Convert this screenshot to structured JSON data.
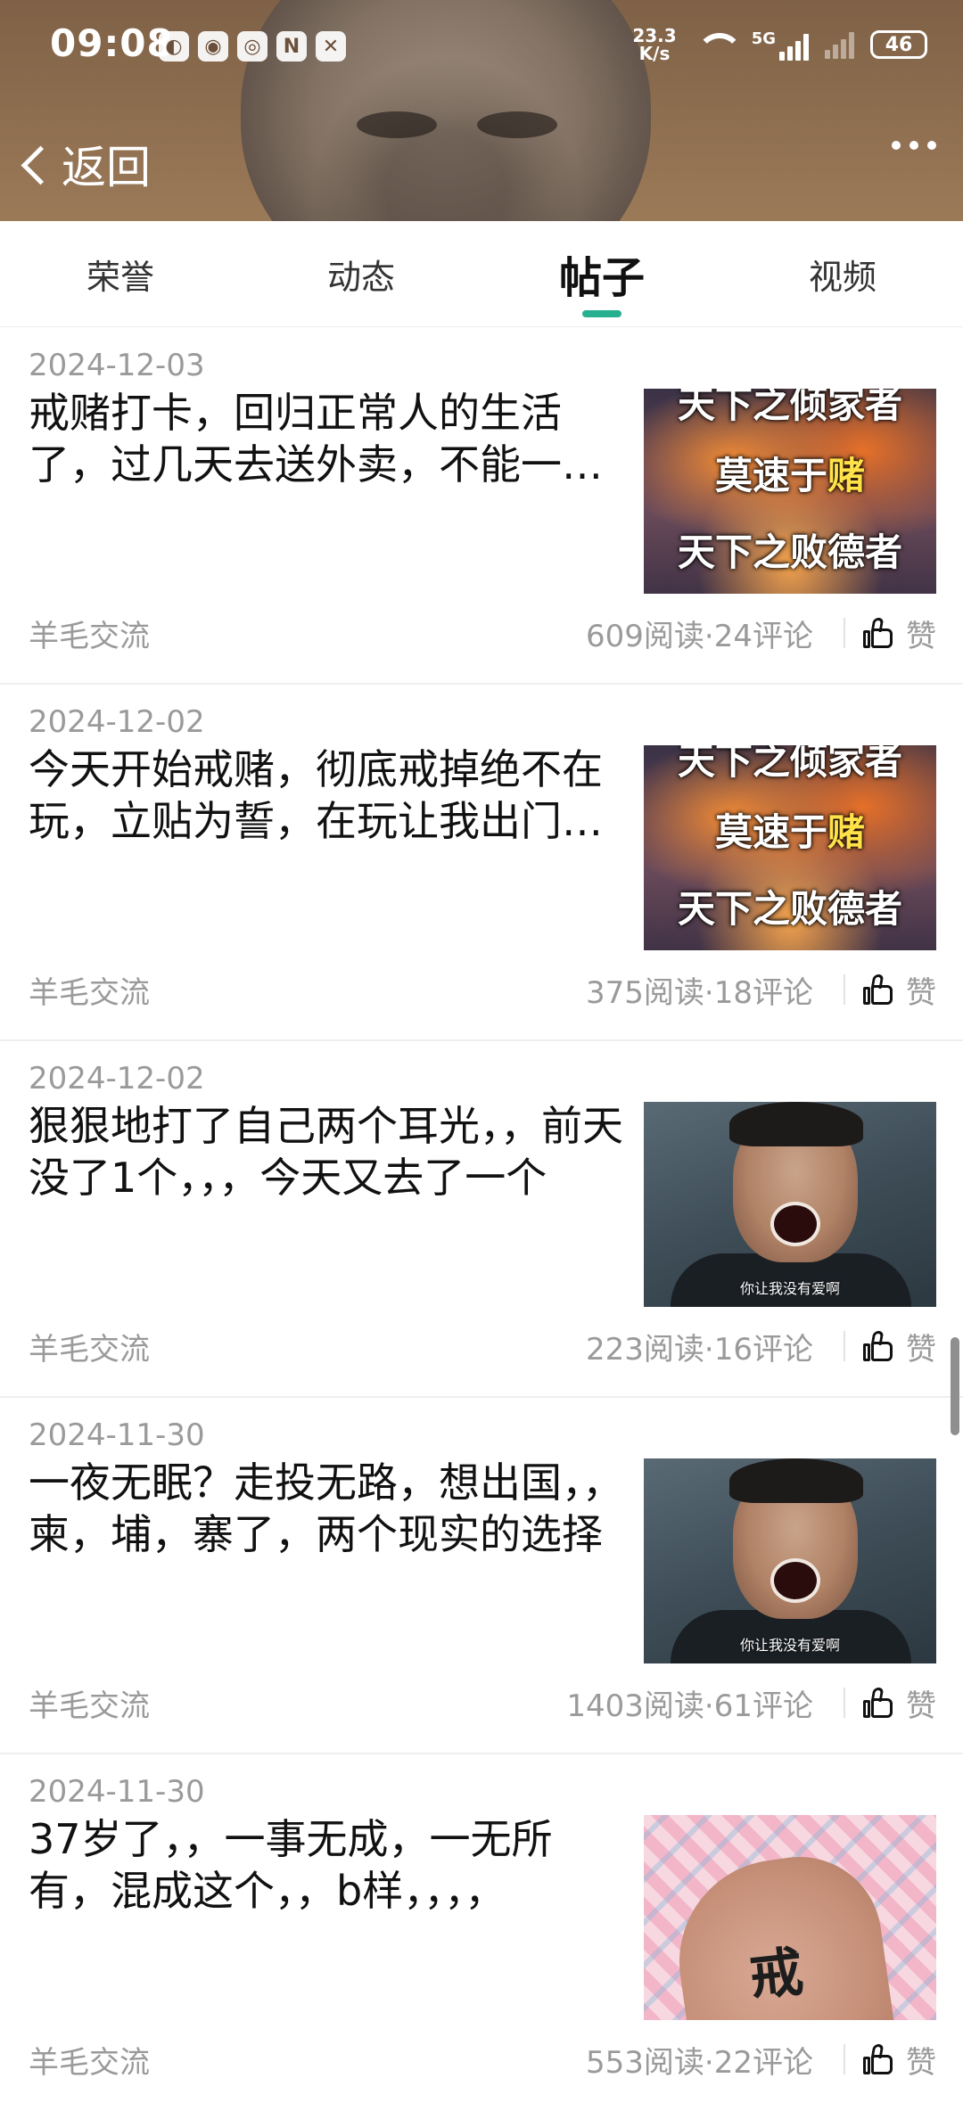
{
  "status_bar": {
    "time": "09:08",
    "net_speed": "23.3",
    "net_speed_unit": "K/s",
    "signal_type": "5G",
    "battery": "46"
  },
  "header": {
    "back_label": "返回"
  },
  "tabs": [
    {
      "label": "荣誉",
      "active": false
    },
    {
      "label": "动态",
      "active": false
    },
    {
      "label": "帖子",
      "active": true
    },
    {
      "label": "视频",
      "active": false
    }
  ],
  "thumb_text": {
    "fire_line1": "天下之倾家者",
    "fire_line2_pre": "莫速于",
    "fire_line2_hl": "赌",
    "fire_line3": "天下之败德者",
    "cry_caption": "你让我没有爱啊",
    "arm_tattoo": "戒"
  },
  "colors": {
    "accent": "#27b08f",
    "highlight": "#ffe14a",
    "muted_text": "#9a9a9a"
  },
  "posts": [
    {
      "date": "2024-12-03",
      "title": "戒赌打卡，回归正常人的生活了，过几天去送外卖，不能一直这样下去",
      "author": "羊毛交流",
      "stats": "609阅读·24评论",
      "like_label": "赞",
      "thumb": "fire"
    },
    {
      "date": "2024-12-02",
      "title": "今天开始戒赌，彻底戒掉绝不在玩，立贴为誓，在玩让我出门被车撞",
      "author": "羊毛交流",
      "stats": "375阅读·18评论",
      "like_label": "赞",
      "thumb": "fire"
    },
    {
      "date": "2024-12-02",
      "title": "狠狠地打了自己两个耳光，，前天没了1个，，，今天又去了一个",
      "author": "羊毛交流",
      "stats": "223阅读·16评论",
      "like_label": "赞",
      "thumb": "cry"
    },
    {
      "date": "2024-11-30",
      "title": "一夜无眠？走投无路，想出国，，柬，埔，寨了，两个现实的选择",
      "author": "羊毛交流",
      "stats": "1403阅读·61评论",
      "like_label": "赞",
      "thumb": "cry"
    },
    {
      "date": "2024-11-30",
      "title": "37岁了，，一事无成，一无所有，混成这个，，b样，，，，",
      "author": "羊毛交流",
      "stats": "553阅读·22评论",
      "like_label": "赞",
      "thumb": "arm"
    }
  ]
}
